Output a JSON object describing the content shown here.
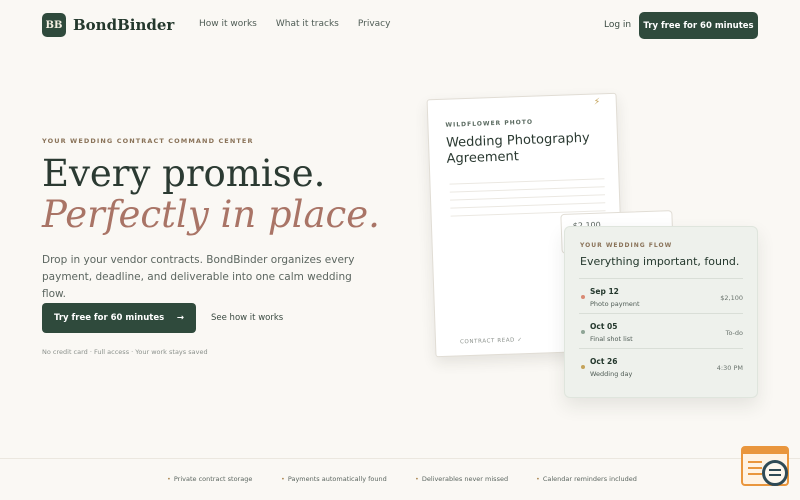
{
  "header": {
    "logo_mark": "BB",
    "brand": "BondBinder",
    "nav": [
      "How it works",
      "What it tracks",
      "Privacy"
    ],
    "login": "Log in",
    "cta": "Try free for 60 minutes"
  },
  "hero": {
    "eyebrow": "YOUR WEDDING CONTRACT COMMAND CENTER",
    "headline_1": "Every promise.",
    "headline_2": "Perfectly in place.",
    "lede": "Drop in your vendor contracts. BondBinder organizes every payment, deadline, and deliverable into one calm wedding flow.",
    "cta": "Try free for 60 minutes",
    "cta_arrow": "→",
    "secondary": "See how it works",
    "fine_print": "No credit card · Full access · Your work stays saved"
  },
  "contract": {
    "vendor": "WILDFLOWER PHOTO",
    "title": "Wedding Photography Agreement",
    "footer": "CONTRACT READ ✓",
    "peek_amount": "$2,100"
  },
  "flow": {
    "label": "YOUR WEDDING FLOW",
    "title": "Everything important, found.",
    "items": [
      {
        "date": "Sep 12",
        "label": "Photo payment",
        "value": "$2,100",
        "color": "#d98a74"
      },
      {
        "date": "Oct 05",
        "label": "Final shot list",
        "value": "To-do",
        "color": "#8fa596"
      },
      {
        "date": "Oct 26",
        "label": "Wedding day",
        "value": "4:30 PM",
        "color": "#c4a35a"
      }
    ]
  },
  "features": [
    "Private contract storage",
    "Payments automatically found",
    "Deliverables never missed",
    "Calendar reminders included"
  ],
  "colors": {
    "primary": "#2f4a3c",
    "accent": "#a97466",
    "background": "#faf8f4"
  }
}
